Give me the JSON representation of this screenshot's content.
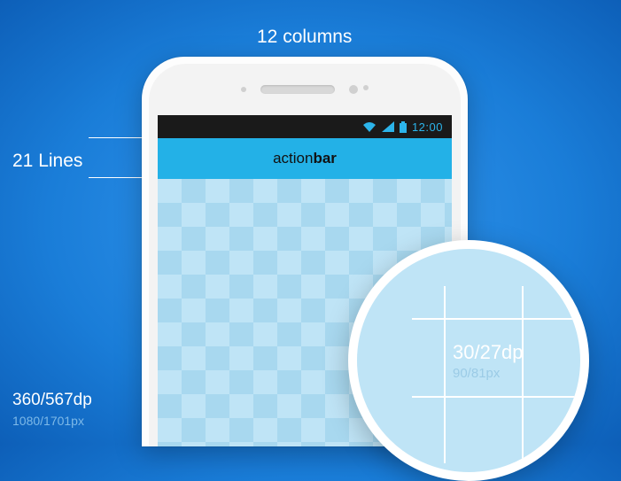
{
  "labels": {
    "columns": "12 columns",
    "lines": "21 Lines",
    "screen_dp": "360/567dp",
    "screen_px": "1080/1701px"
  },
  "statusbar": {
    "time": "12:00"
  },
  "actionbar": {
    "prefix": "action",
    "bold": "bar"
  },
  "zoom": {
    "cell_dp": "30/27dp",
    "cell_px": "90/81px"
  }
}
